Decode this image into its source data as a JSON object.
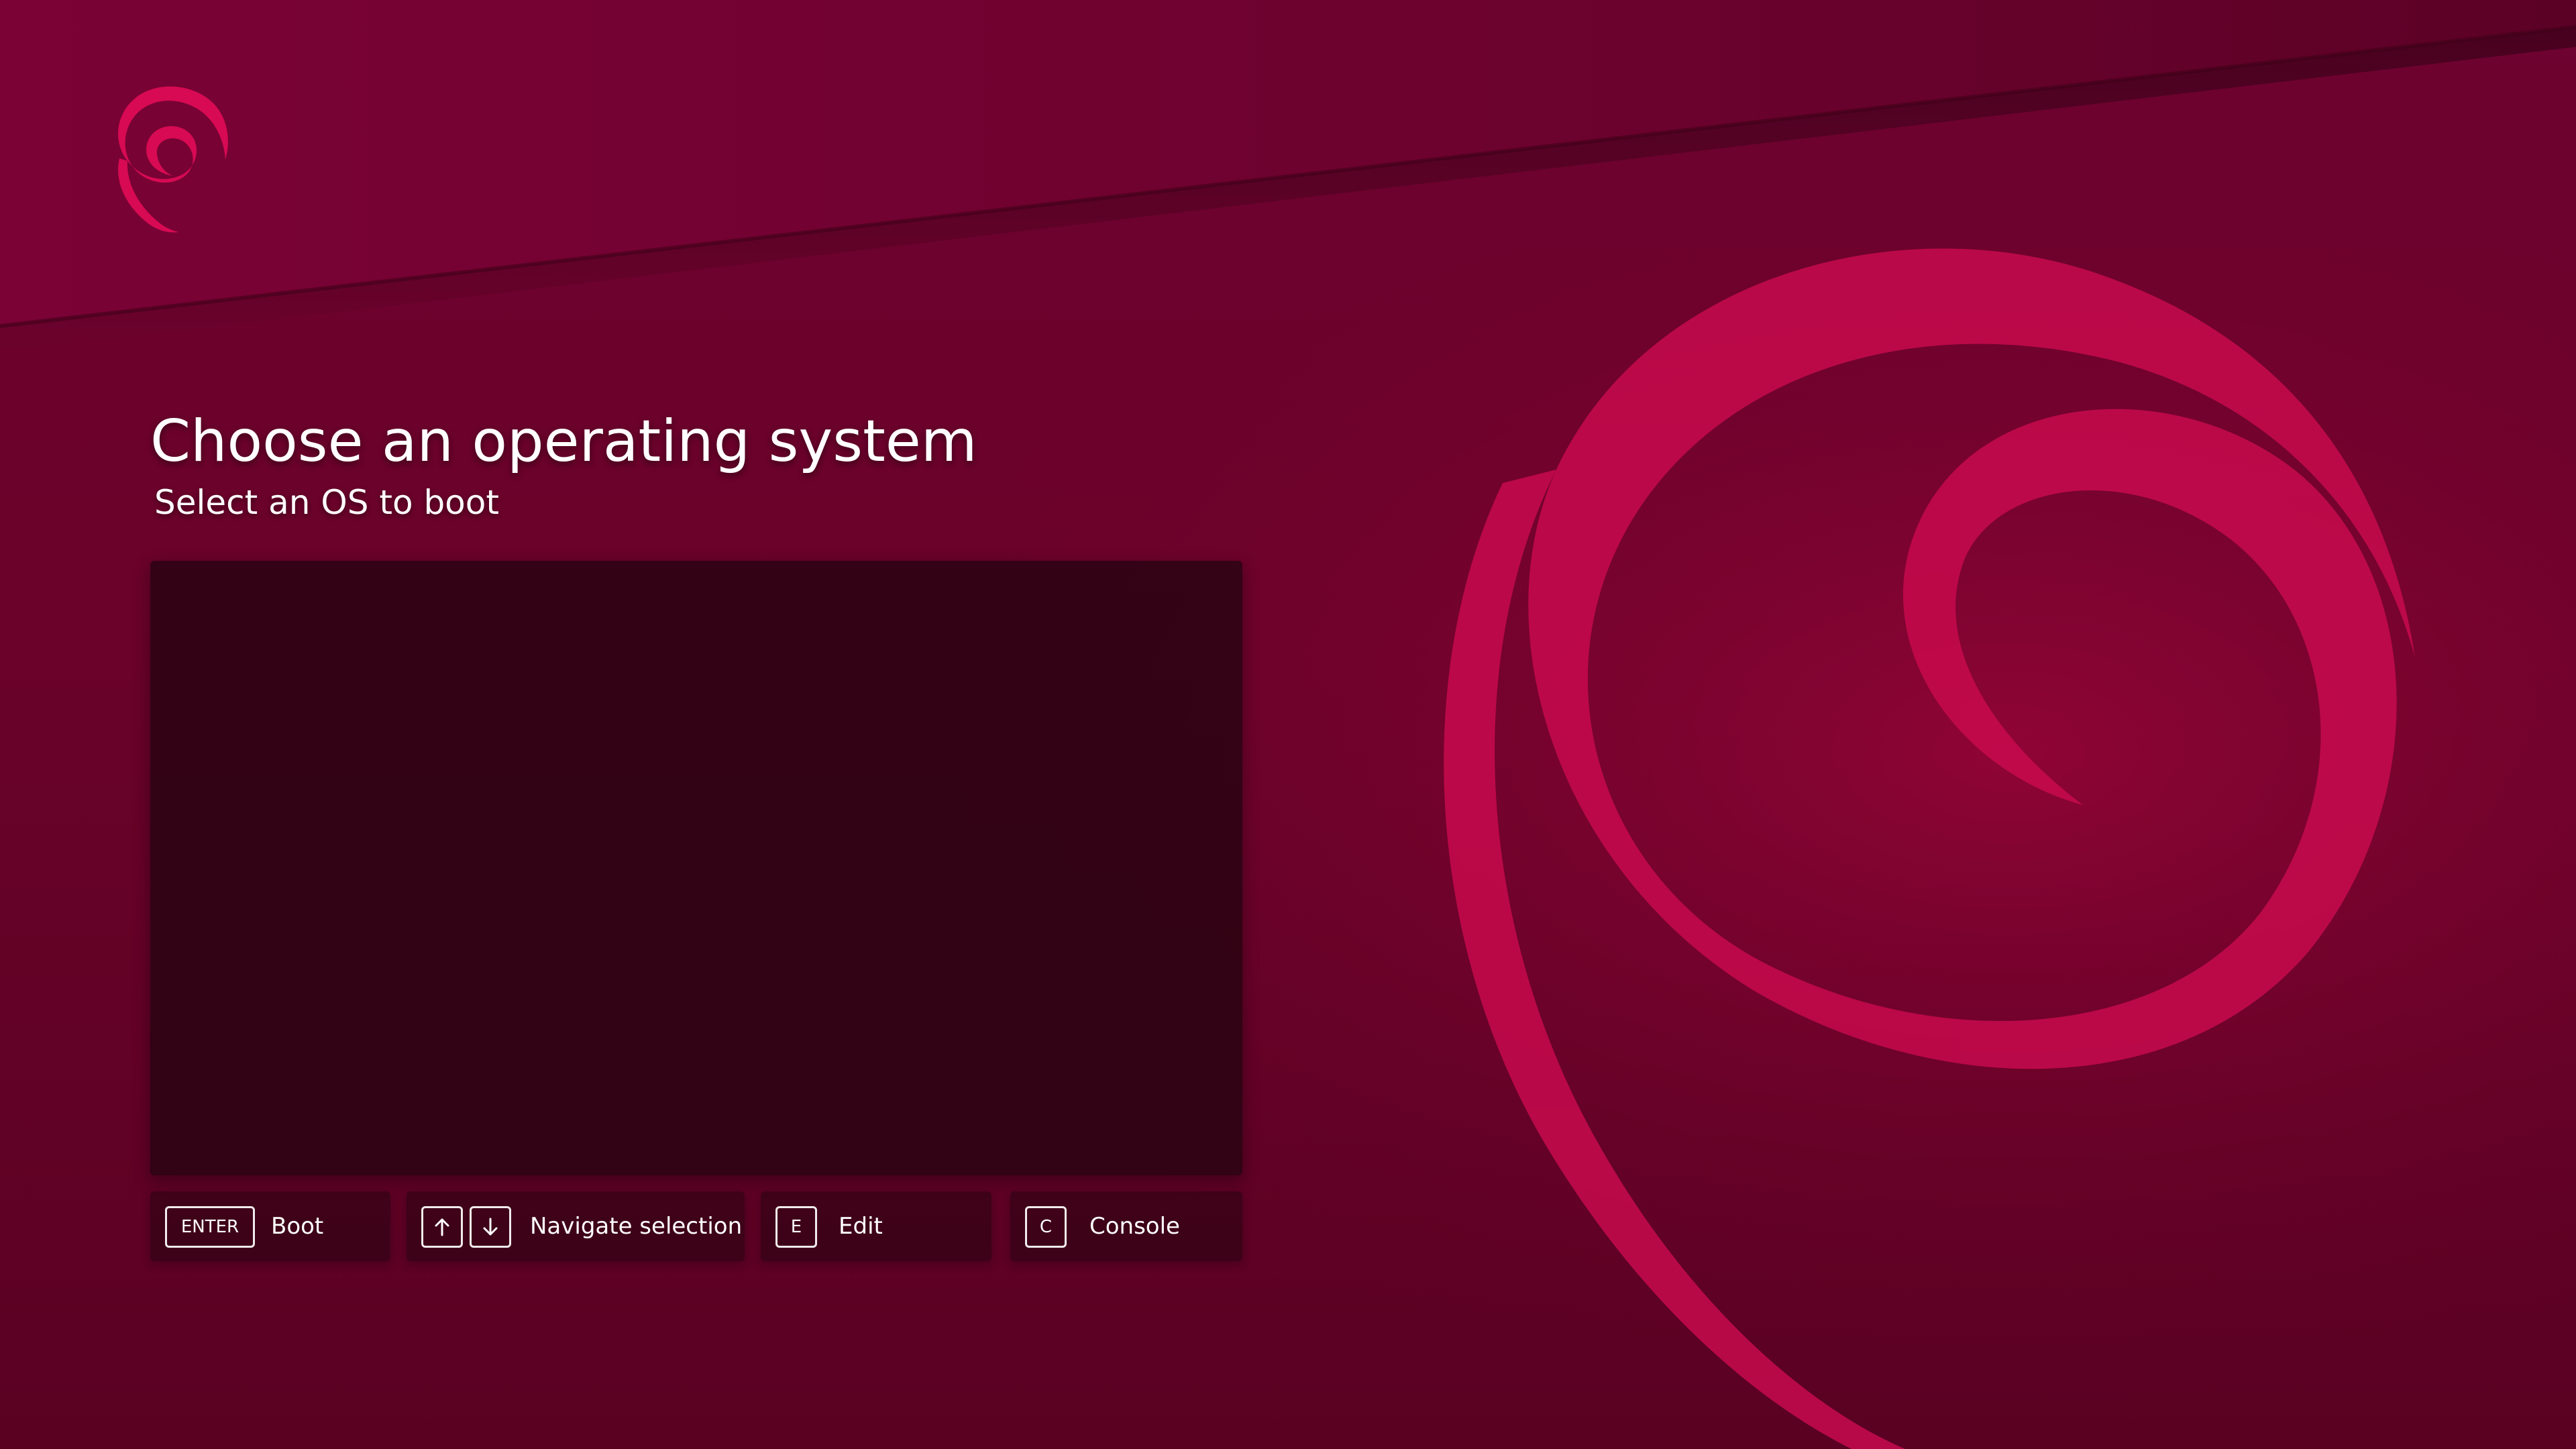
{
  "screen": {
    "title": "Choose an operating system",
    "subtitle": "Select an OS to boot"
  },
  "os_list": {
    "entries": []
  },
  "hints": [
    {
      "keys": [
        "ENTER"
      ],
      "label": "Boot"
    },
    {
      "keys": [
        "arrow-up-icon",
        "arrow-down-icon"
      ],
      "label": "Navigate selection"
    },
    {
      "keys": [
        "E"
      ],
      "label": "Edit"
    },
    {
      "keys": [
        "C"
      ],
      "label": "Console"
    }
  ],
  "theme": {
    "background": "#6a0229",
    "accent": "#d70a53",
    "panel": "#2a0412",
    "text": "#ffffff"
  }
}
